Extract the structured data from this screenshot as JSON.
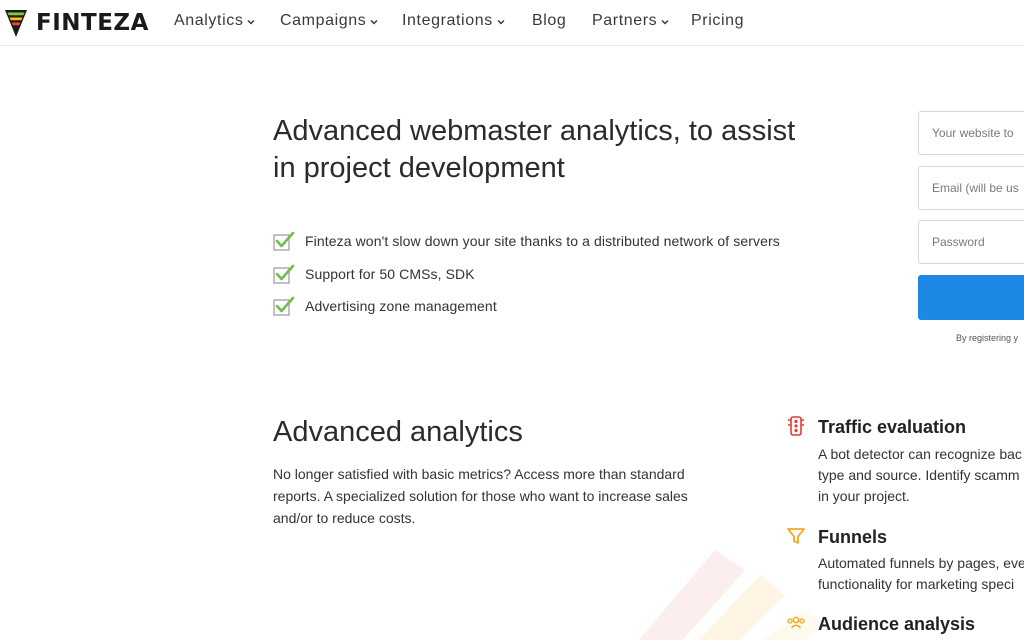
{
  "header": {
    "logo_text": "FINTEZA",
    "nav": [
      {
        "label": "Analytics",
        "has_dropdown": true
      },
      {
        "label": "Campaigns",
        "has_dropdown": true
      },
      {
        "label": "Integrations",
        "has_dropdown": true
      },
      {
        "label": "Blog",
        "has_dropdown": false
      },
      {
        "label": "Partners",
        "has_dropdown": true
      },
      {
        "label": "Pricing",
        "has_dropdown": false
      }
    ]
  },
  "hero": {
    "title_line1": "Advanced webmaster analytics, to assist",
    "title_line2": "in project development",
    "features": [
      "Finteza won't slow down your site thanks to a distributed network of servers",
      "Support for 50 CMSs, SDK",
      "Advertising zone management"
    ]
  },
  "signup": {
    "website_placeholder": "Your website to",
    "email_placeholder": "Email (will be us",
    "password_placeholder": "Password",
    "terms_text": "By registering y"
  },
  "analytics": {
    "title": "Advanced analytics",
    "description_lines": [
      "No longer satisfied with basic metrics? Access more than standard",
      "reports. A specialized solution for those who want to increase sales",
      "and/or to reduce costs."
    ],
    "items": [
      {
        "icon": "traffic-light-icon",
        "title": "Traffic evaluation",
        "lines": [
          "A bot detector can recognize bac",
          "type and source. Identify scamm",
          "in your project."
        ]
      },
      {
        "icon": "funnel-icon",
        "title": "Funnels",
        "lines": [
          "Automated funnels by pages, eve",
          "functionality for marketing speci"
        ]
      },
      {
        "icon": "audience-icon",
        "title": "Audience analysis",
        "lines": []
      }
    ]
  },
  "colors": {
    "accent_blue": "#1e88e5",
    "check_green": "#6cc04a",
    "traffic_red": "#e53935",
    "funnel_orange": "#f5a623"
  }
}
